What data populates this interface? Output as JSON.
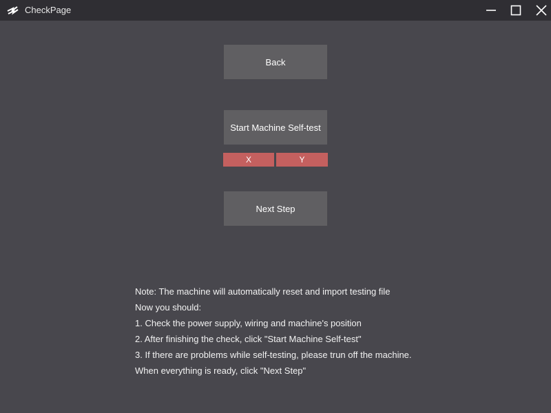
{
  "window": {
    "title": "CheckPage",
    "icons": {
      "app": "app-logo-icon",
      "minimize": "minimize-icon",
      "maximize": "maximize-icon",
      "close": "close-icon"
    }
  },
  "buttons": {
    "back": "Back",
    "start_self_test": "Start Machine Self-test",
    "next_step": "Next Step"
  },
  "axis_status": {
    "x": "X",
    "y": "Y",
    "color": "#c4605f"
  },
  "notes": [
    "Note: The machine will automatically reset and import testing file",
    "Now you should:",
    "1. Check the power supply, wiring and machine's position",
    "2. After finishing the check, click \"Start Machine Self-test\"",
    "3. If there are problems while self-testing, please trun off the machine.",
    "When everything is ready, click \"Next Step\""
  ],
  "colors": {
    "background": "#48474d",
    "titlebar": "#2f2e33",
    "button": "#605f62"
  }
}
